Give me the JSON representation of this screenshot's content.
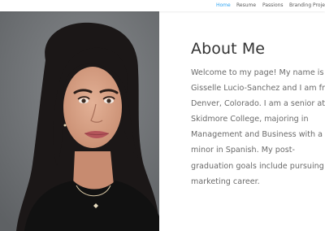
{
  "nav": {
    "items": [
      {
        "label": "Home",
        "active": true
      },
      {
        "label": "Resume",
        "active": false
      },
      {
        "label": "Passions",
        "active": false
      },
      {
        "label": "Branding Project",
        "active": false
      }
    ],
    "active_color": "#2ea3f2",
    "text_color": "#5a5a5a"
  },
  "hero": {
    "image": "portrait-photo",
    "background_color": "#6f7275"
  },
  "about": {
    "title": "About Me",
    "lines": [
      "Welcome to my page! My name is",
      "Gisselle Lucio-Sanchez and I am from",
      "Denver, Colorado. I am a senior at",
      "Skidmore College, majoring in",
      "Management and Business with a",
      "minor in Spanish. My post-",
      "graduation goals include pursuing a",
      "marketing career."
    ]
  }
}
